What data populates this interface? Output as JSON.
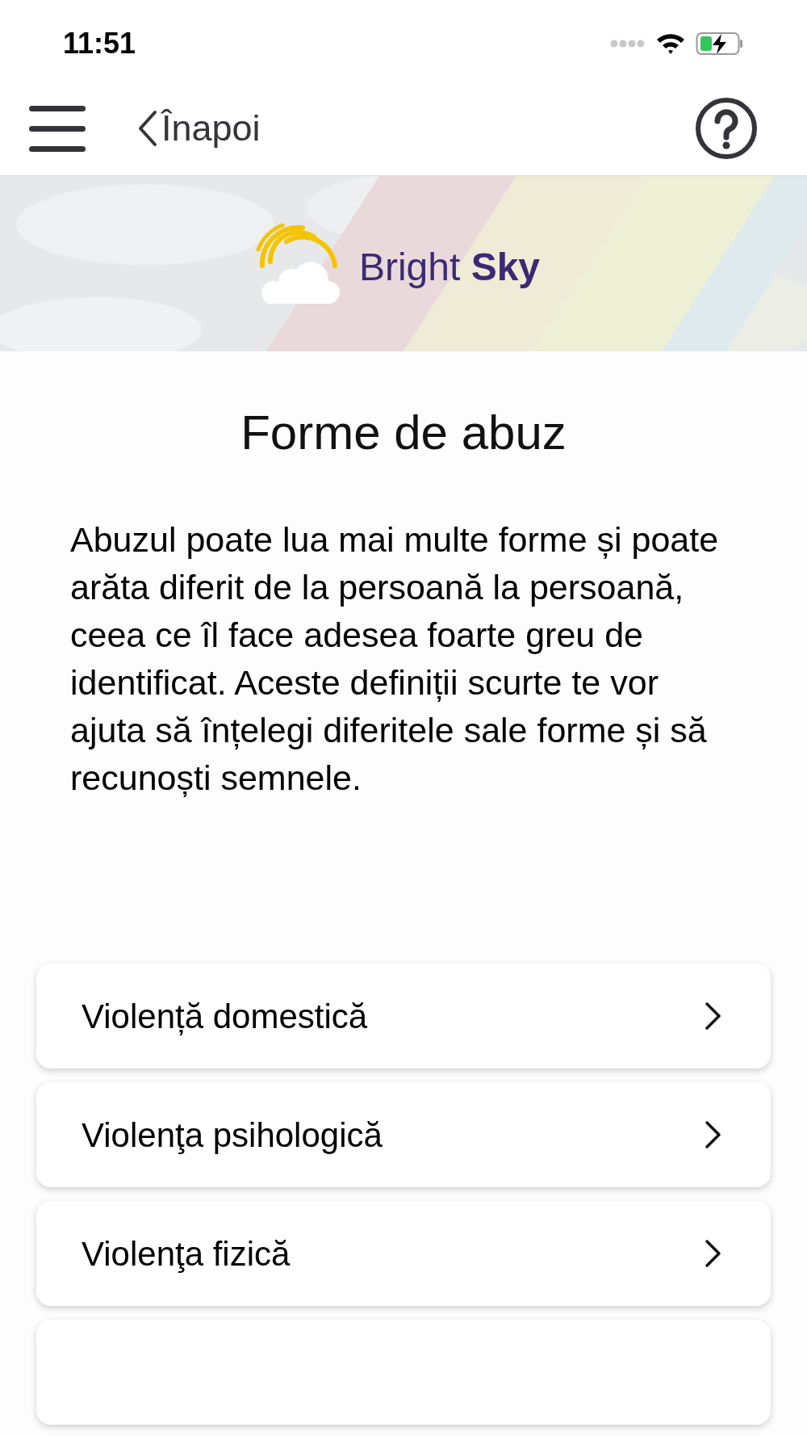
{
  "status_bar": {
    "time": "11:51"
  },
  "nav_bar": {
    "back_label": "Înapoi"
  },
  "banner": {
    "kind": "picture",
    "logo_text": "Bright **Sky**"
  },
  "title": "Forme de abuz",
  "intro": "Abuzul poate lua mai multe forme și poate arăta diferit de la persoană la persoană, ceea ce îl face adesea foarte greu de identificat. Aceste definiții scurte te vor ajuta să înțelegi diferitele sale forme și să recunoști semnele.",
  "items": [
    {
      "kind": "link",
      "label": "Violență domestică"
    },
    {
      "kind": "link",
      "label": "Violenţa psihologică"
    },
    {
      "kind": "link",
      "label": "Violenţa fizică"
    },
    {
      "kind": "cut"
    }
  ]
}
